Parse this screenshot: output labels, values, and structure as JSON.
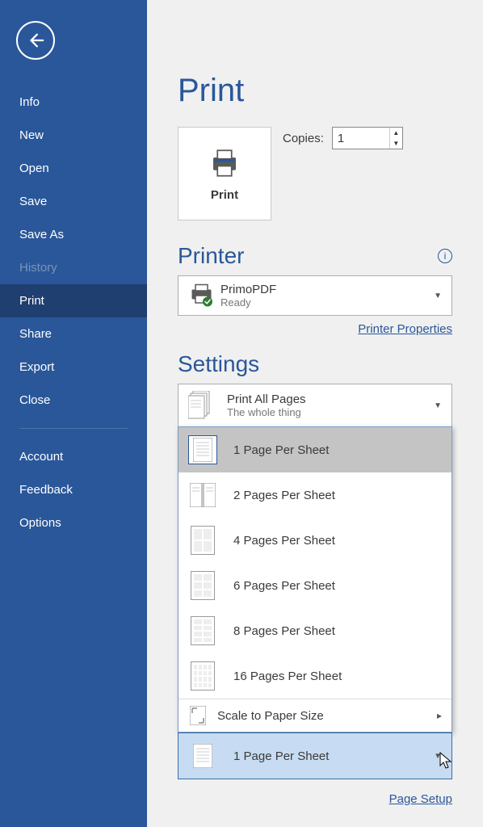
{
  "sidebar": {
    "items": [
      {
        "label": "Info"
      },
      {
        "label": "New"
      },
      {
        "label": "Open"
      },
      {
        "label": "Save"
      },
      {
        "label": "Save As"
      },
      {
        "label": "History"
      },
      {
        "label": "Print"
      },
      {
        "label": "Share"
      },
      {
        "label": "Export"
      },
      {
        "label": "Close"
      }
    ],
    "footer": [
      {
        "label": "Account"
      },
      {
        "label": "Feedback"
      },
      {
        "label": "Options"
      }
    ]
  },
  "page": {
    "title": "Print",
    "print_button": "Print",
    "copies_label": "Copies:",
    "copies_value": "1"
  },
  "printer": {
    "heading": "Printer",
    "name": "PrimoPDF",
    "status": "Ready",
    "properties_link": "Printer Properties"
  },
  "settings": {
    "heading": "Settings",
    "print_all": "Print All Pages",
    "print_all_sub": "The whole thing",
    "menu": [
      "1 Page Per Sheet",
      "2 Pages Per Sheet",
      "4 Pages Per Sheet",
      "6 Pages Per Sheet",
      "8 Pages Per Sheet",
      "16 Pages Per Sheet"
    ],
    "scale_label": "Scale to Paper Size",
    "selected": "1 Page Per Sheet",
    "page_setup_link": "Page Setup"
  }
}
